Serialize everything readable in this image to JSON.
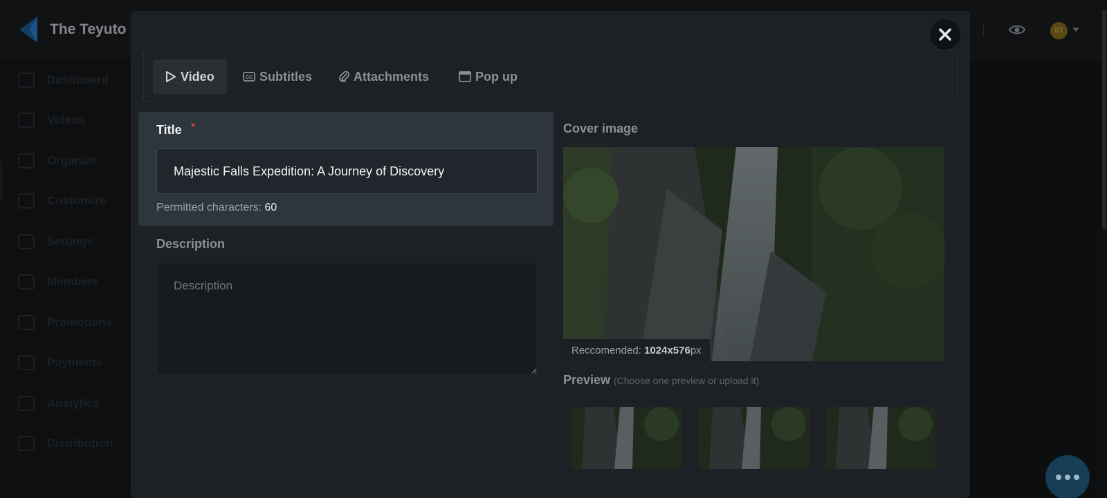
{
  "app": {
    "brand_name": "The Teyuto I",
    "avatar_initials": "ST"
  },
  "sidebar": {
    "items": [
      {
        "label": "Dashboard",
        "icon": "home-icon"
      },
      {
        "label": "Videos",
        "icon": "video-icon"
      },
      {
        "label": "Organize",
        "icon": "organize-icon"
      },
      {
        "label": "Customize",
        "icon": "brush-icon"
      },
      {
        "label": "Settings",
        "icon": "gear-icon"
      },
      {
        "label": "Members",
        "icon": "members-icon"
      },
      {
        "label": "Promotions",
        "icon": "tag-icon"
      },
      {
        "label": "Payments",
        "icon": "card-icon"
      },
      {
        "label": "Analytics",
        "icon": "chart-icon"
      },
      {
        "label": "Distribution",
        "icon": "share-icon"
      }
    ]
  },
  "modal": {
    "tabs": [
      {
        "label": "Video",
        "icon": "play-icon"
      },
      {
        "label": "Subtitles",
        "icon": "cc-icon"
      },
      {
        "label": "Attachments",
        "icon": "paperclip-icon"
      },
      {
        "label": "Pop up",
        "icon": "window-icon"
      }
    ],
    "title_label": "Title",
    "required_mark": "*",
    "title_value": "Majestic Falls Expedition: A Journey of Discovery",
    "permitted_label": "Permitted characters:",
    "permitted_count": "60",
    "description_label": "Description",
    "description_placeholder": "Description",
    "cover_label": "Cover image",
    "recommended_prefix": "Reccomended:",
    "recommended_size": "1024x576",
    "recommended_unit": "px",
    "preview_label": "Preview",
    "preview_hint": "(Choose one preview or upload it)"
  },
  "colors": {
    "accent_blue": "#2a7fd4",
    "required_red": "#d84040",
    "avatar_gold": "#8a6f1e"
  }
}
